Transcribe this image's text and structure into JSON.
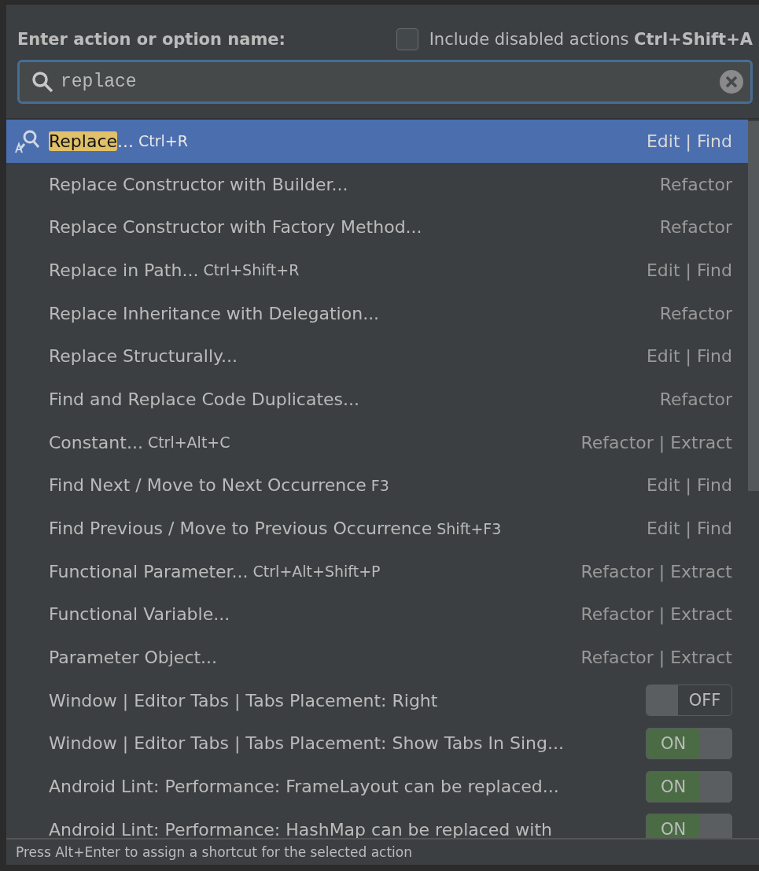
{
  "header": {
    "label": "Enter action or option name:",
    "include_disabled": {
      "label": "Include disabled actions",
      "shortcut": "Ctrl+Shift+A",
      "checked": false
    }
  },
  "search": {
    "value": "replace"
  },
  "items": [
    {
      "kind": "action",
      "highlight": "Replace",
      "name": "...",
      "shortcut": "Ctrl+R",
      "category": "Edit | Find",
      "selected": true
    },
    {
      "kind": "action",
      "name": "Replace Constructor with Builder...",
      "category": "Refactor",
      "selected": false
    },
    {
      "kind": "action",
      "name": "Replace Constructor with Factory Method...",
      "category": "Refactor",
      "selected": false
    },
    {
      "kind": "action",
      "name": "Replace in Path...",
      "shortcut": "Ctrl+Shift+R",
      "category": "Edit | Find",
      "selected": false
    },
    {
      "kind": "action",
      "name": "Replace Inheritance with Delegation...",
      "category": "Refactor",
      "selected": false
    },
    {
      "kind": "action",
      "name": "Replace Structurally...",
      "category": "Edit | Find",
      "selected": false
    },
    {
      "kind": "action",
      "name": "Find and Replace Code Duplicates...",
      "category": "Refactor",
      "selected": false
    },
    {
      "kind": "action",
      "name": "Constant...",
      "shortcut": "Ctrl+Alt+C",
      "category": "Refactor | Extract",
      "selected": false
    },
    {
      "kind": "action",
      "name": "Find Next / Move to Next Occurrence",
      "shortcut": "F3",
      "category": "Edit | Find",
      "selected": false
    },
    {
      "kind": "action",
      "name": "Find Previous / Move to Previous Occurrence",
      "shortcut": "Shift+F3",
      "category": "Edit | Find",
      "selected": false
    },
    {
      "kind": "action",
      "name": "Functional Parameter...",
      "shortcut": "Ctrl+Alt+Shift+P",
      "category": "Refactor | Extract",
      "selected": false
    },
    {
      "kind": "action",
      "name": "Functional Variable...",
      "category": "Refactor | Extract",
      "selected": false
    },
    {
      "kind": "action",
      "name": "Parameter Object...",
      "category": "Refactor | Extract",
      "selected": false
    },
    {
      "kind": "toggle",
      "name": "Window | Editor Tabs | Tabs Placement: Right",
      "on": false,
      "toggle_label": "OFF",
      "selected": false
    },
    {
      "kind": "toggle",
      "name": "Window | Editor Tabs | Tabs Placement: Show Tabs In Sing...",
      "on": true,
      "toggle_label": "ON",
      "selected": false
    },
    {
      "kind": "toggle",
      "name": "Android Lint: Performance: FrameLayout can be replaced...",
      "on": true,
      "toggle_label": "ON",
      "selected": false
    },
    {
      "kind": "toggle",
      "name": "Android Lint: Performance: HashMap can be replaced with",
      "on": true,
      "toggle_label": "ON",
      "selected": false
    }
  ],
  "status_bar": "Press Alt+Enter to assign a shortcut for the selected action"
}
